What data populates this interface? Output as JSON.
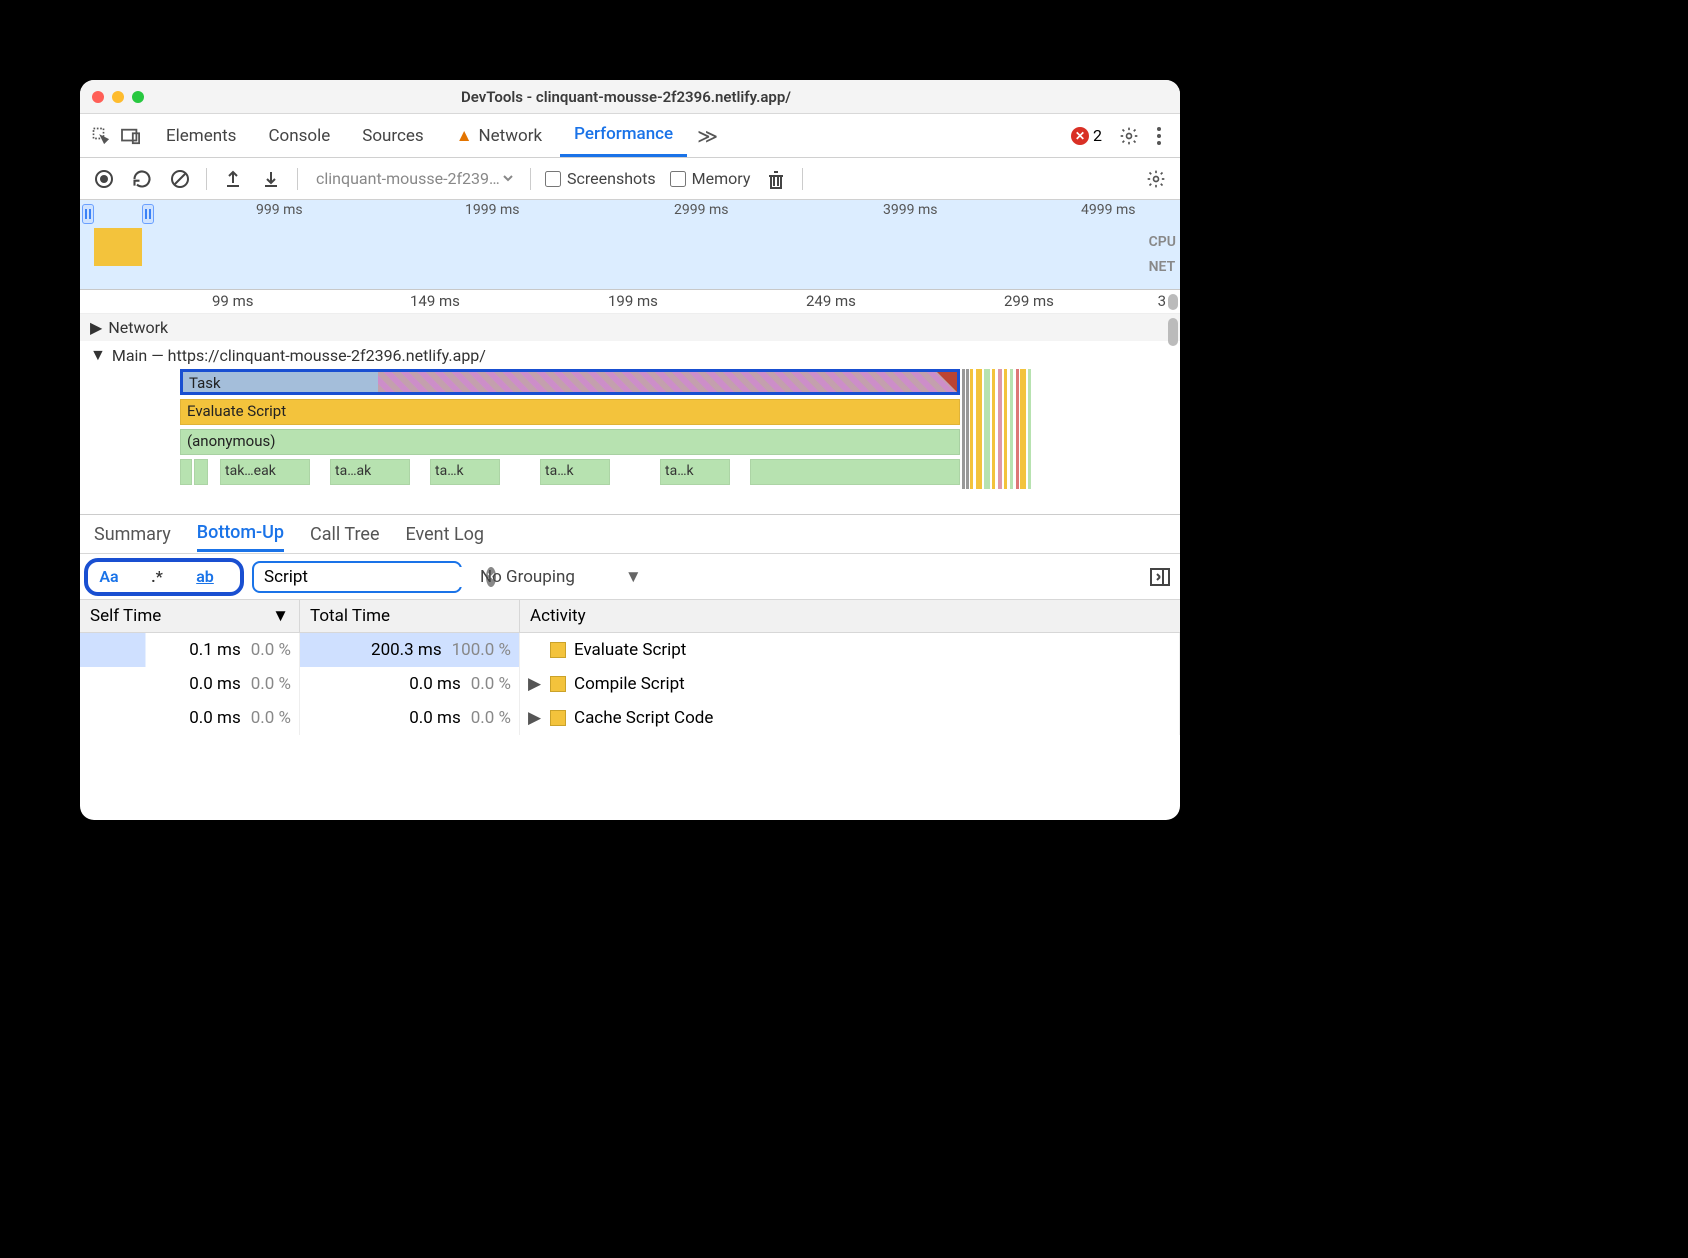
{
  "window": {
    "title": "DevTools - clinquant-mousse-2f2396.netlify.app/"
  },
  "tabs": {
    "elements": "Elements",
    "console": "Console",
    "sources": "Sources",
    "network": "Network",
    "performance": "Performance",
    "more": "≫",
    "error_count": "2"
  },
  "perf_toolbar": {
    "recording_name": "clinquant-mousse-2f239…",
    "screenshots_label": "Screenshots",
    "memory_label": "Memory"
  },
  "overview": {
    "ticks": [
      "999 ms",
      "1999 ms",
      "2999 ms",
      "3999 ms",
      "4999 ms"
    ],
    "side_labels": {
      "cpu": "CPU",
      "net": "NET"
    }
  },
  "ruler2": {
    "ticks": [
      "99 ms",
      "149 ms",
      "199 ms",
      "249 ms",
      "299 ms",
      "3"
    ]
  },
  "tracks": {
    "network_label": "Network",
    "main_label": "Main — https://clinquant-mousse-2f2396.netlify.app/",
    "task_label": "Task",
    "evaluate_label": "Evaluate Script",
    "anonymous_label": "(anonymous)",
    "leaves": [
      "tak…eak",
      "ta…ak",
      "ta…k",
      "ta…k",
      "ta…k"
    ]
  },
  "lower_tabs": {
    "summary": "Summary",
    "bottom_up": "Bottom-Up",
    "call_tree": "Call Tree",
    "event_log": "Event Log"
  },
  "filter": {
    "case_btn": "Aa",
    "regex_btn": ".*",
    "whole_btn": "ab",
    "value": "Script",
    "grouping": "No Grouping"
  },
  "table": {
    "headers": {
      "self": "Self Time",
      "total": "Total Time",
      "activity": "Activity"
    },
    "rows": [
      {
        "self_ms": "0.1 ms",
        "self_pct": "0.0 %",
        "total_ms": "200.3 ms",
        "total_pct": "100.0 %",
        "activity": "Evaluate Script",
        "expandable": false
      },
      {
        "self_ms": "0.0 ms",
        "self_pct": "0.0 %",
        "total_ms": "0.0 ms",
        "total_pct": "0.0 %",
        "activity": "Compile Script",
        "expandable": true
      },
      {
        "self_ms": "0.0 ms",
        "self_pct": "0.0 %",
        "total_ms": "0.0 ms",
        "total_pct": "0.0 %",
        "activity": "Cache Script Code",
        "expandable": true
      }
    ]
  }
}
